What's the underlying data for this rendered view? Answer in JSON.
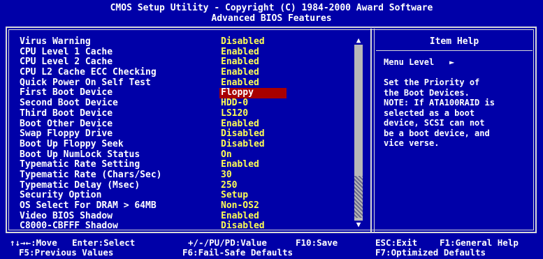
{
  "header": {
    "line1": "CMOS Setup Utility - Copyright (C) 1984-2000 Award Software",
    "line2": "Advanced BIOS Features"
  },
  "settings": [
    {
      "label": "Virus Warning",
      "value": "Disabled"
    },
    {
      "label": "CPU Level 1 Cache",
      "value": "Enabled"
    },
    {
      "label": "CPU Level 2 Cache",
      "value": "Enabled"
    },
    {
      "label": "CPU L2 Cache ECC Checking",
      "value": "Enabled"
    },
    {
      "label": "Quick Power On Self Test",
      "value": "Enabled"
    },
    {
      "label": "First Boot Device",
      "value": "Floppy"
    },
    {
      "label": "Second Boot Device",
      "value": "HDD-0"
    },
    {
      "label": "Third Boot Device",
      "value": "LS120"
    },
    {
      "label": "Boot Other Device",
      "value": "Enabled"
    },
    {
      "label": "Swap Floppy Drive",
      "value": "Disabled"
    },
    {
      "label": "Boot Up Floppy Seek",
      "value": "Disabled"
    },
    {
      "label": "Boot Up NumLock Status",
      "value": "On"
    },
    {
      "label": "Typematic Rate Setting",
      "value": "Enabled"
    },
    {
      "label": "Typematic Rate (Chars/Sec)",
      "value": "30"
    },
    {
      "label": "Typematic Delay (Msec)",
      "value": "250"
    },
    {
      "label": "Security Option",
      "value": "Setup"
    },
    {
      "label": "OS Select For DRAM > 64MB",
      "value": "Non-OS2"
    },
    {
      "label": "Video BIOS Shadow",
      "value": "Enabled"
    },
    {
      "label": "C8000-CBFFF Shadow",
      "value": "Disabled"
    }
  ],
  "selected_index": 5,
  "help": {
    "title": "Item Help",
    "menu_level": "Menu Level",
    "menu_level_arrow": "►",
    "text": "Set the Priority of\nthe Boot Devices.\nNOTE: If ATA100RAID is\nselected as a boot\ndevice, SCSI can not\nbe a boot device, and\nvice verse."
  },
  "scrollbar": {
    "up_glyph": "▲",
    "down_glyph": "▼"
  },
  "footer": {
    "move": "↑↓→←:Move",
    "enter": "Enter:Select",
    "value": "+/-/PU/PD:Value",
    "save": "F10:Save",
    "exit": "ESC:Exit",
    "help": "F1:General Help",
    "prev": "F5:Previous Values",
    "failsafe": "F6:Fail-Safe Defaults",
    "optimized": "F7:Optimized Defaults"
  },
  "colors": {
    "background": "#0000a8",
    "value_text": "#ffff54",
    "label_text": "#ffffff",
    "selection": "#a80000",
    "frame": "#d8d8d8"
  }
}
